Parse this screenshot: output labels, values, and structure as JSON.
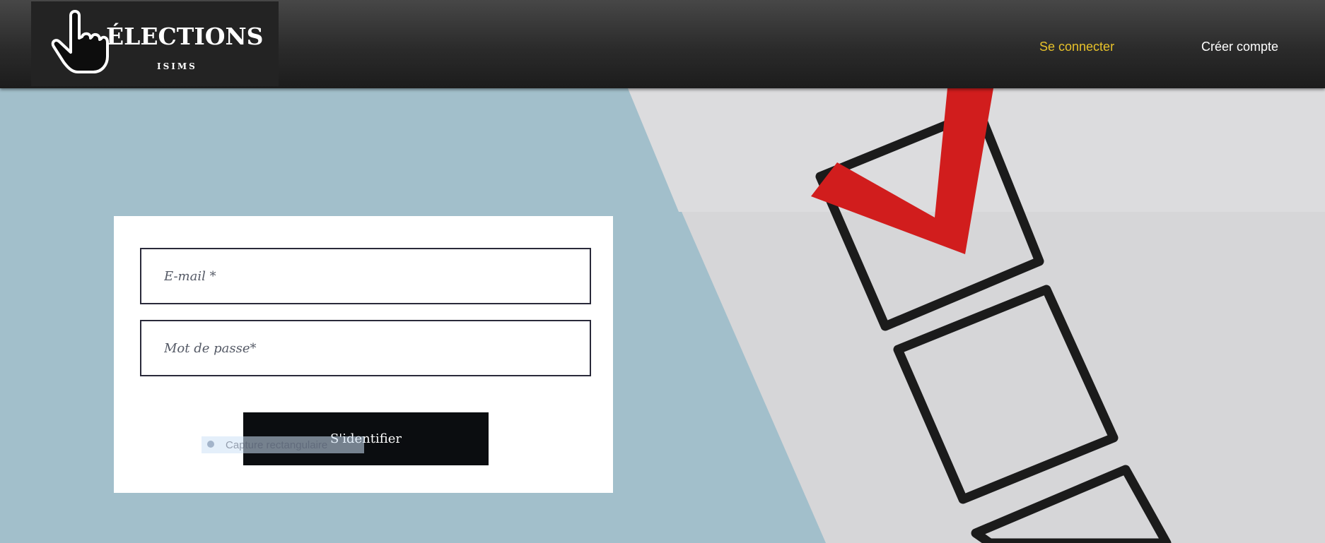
{
  "header": {
    "logo": {
      "title": "ÉLECTIONS",
      "subtitle": "ISIMS"
    },
    "nav": {
      "login": "Se connecter",
      "register": "Créer compte"
    }
  },
  "form": {
    "email_placeholder": "E-mail *",
    "password_placeholder": "Mot de passe*",
    "submit_label": "S'identifier",
    "overlay_tooltip": "Capture rectangulaire"
  },
  "colors": {
    "header_bg": "#2b2b2b",
    "active_nav": "#e8c22a",
    "background": "#a2bfcb",
    "button_bg": "#0b0d10",
    "check_red": "#d11d1d"
  },
  "icons": {
    "logo_icon": "pointing-hand-icon",
    "background_art": "ballot-checkboxes"
  }
}
